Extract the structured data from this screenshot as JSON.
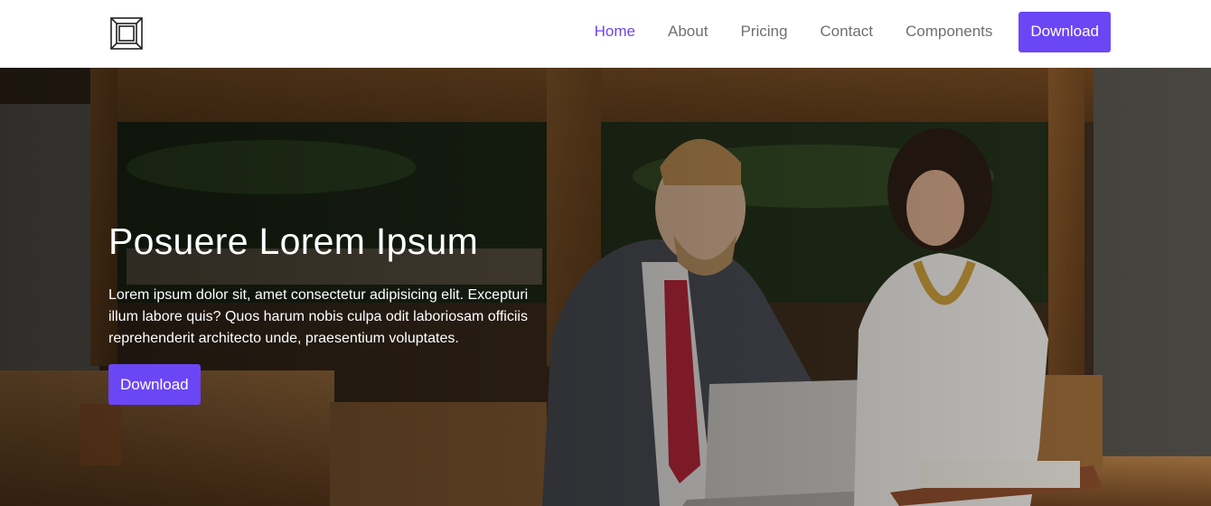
{
  "nav": {
    "logo_icon": "cube-outline-logo",
    "links": [
      {
        "label": "Home",
        "active": true
      },
      {
        "label": "About",
        "active": false
      },
      {
        "label": "Pricing",
        "active": false
      },
      {
        "label": "Contact",
        "active": false
      },
      {
        "label": "Components",
        "active": false
      }
    ],
    "download_label": "Download"
  },
  "hero": {
    "title": "Posuere Lorem Ipsum",
    "text": "Lorem ipsum dolor sit, amet consectetur adipisicing elit. Excepturi illum labore quis? Quos harum nobis culpa odit laboriosam officiis reprehenderit architecto unde, praesentium voluptates.",
    "button_label": "Download",
    "image_subject": "two people working at a laptop in a cafe"
  },
  "colors": {
    "accent": "#6b46f5",
    "nav_text": "#6f6f6f",
    "hero_text": "#ffffff"
  }
}
